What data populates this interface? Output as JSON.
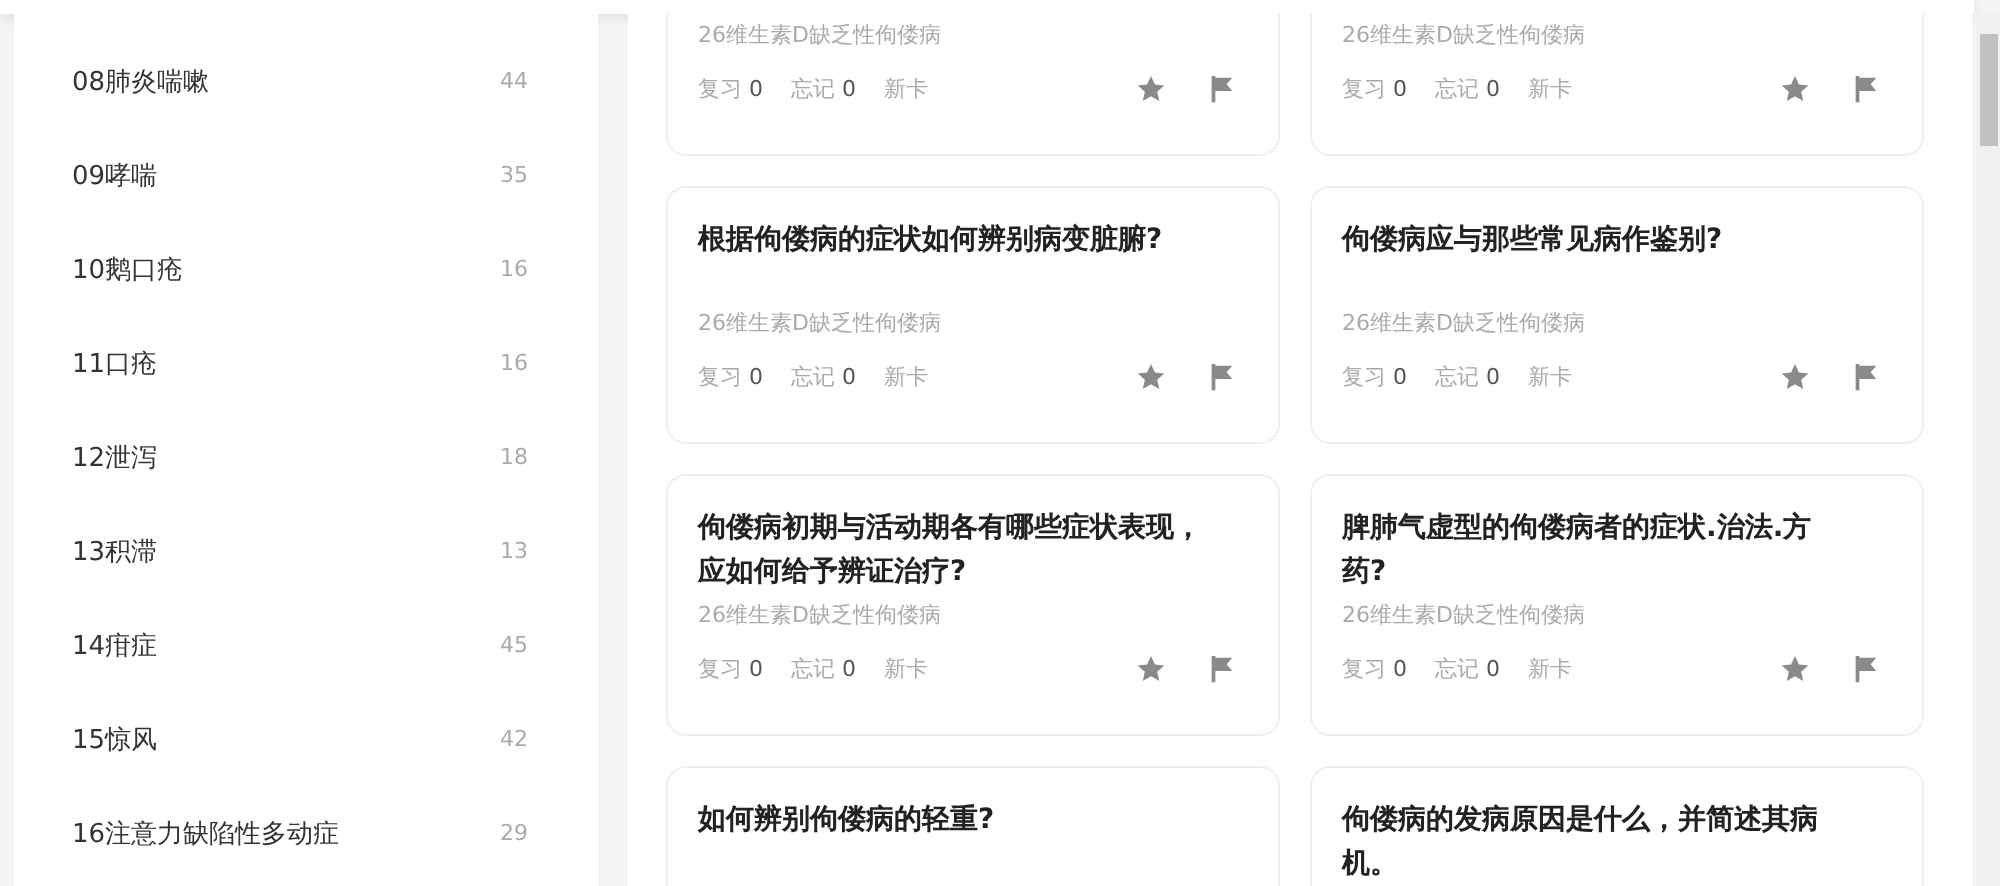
{
  "sidebar": {
    "items": [
      {
        "label": "08肺炎喘嗽",
        "count": "44"
      },
      {
        "label": "09哮喘",
        "count": "35"
      },
      {
        "label": "10鹅口疮",
        "count": "16"
      },
      {
        "label": "11口疮",
        "count": "16"
      },
      {
        "label": "12泄泻",
        "count": "18"
      },
      {
        "label": "13积滞",
        "count": "13"
      },
      {
        "label": "14疳症",
        "count": "45"
      },
      {
        "label": "15惊风",
        "count": "42"
      },
      {
        "label": "16注意力缺陷性多动症",
        "count": "29"
      }
    ]
  },
  "cards": [
    {
      "deck": "26维生素D缺乏性佝偻病",
      "review_label": "复习",
      "review_count": "0",
      "forget_label": "忘记",
      "forget_count": "0",
      "status": "新卡"
    },
    {
      "deck": "26维生素D缺乏性佝偻病",
      "review_label": "复习",
      "review_count": "0",
      "forget_label": "忘记",
      "forget_count": "0",
      "status": "新卡"
    },
    {
      "title": "根据佝偻病的症状如何辨别病变脏腑?",
      "deck": "26维生素D缺乏性佝偻病",
      "review_label": "复习",
      "review_count": "0",
      "forget_label": "忘记",
      "forget_count": "0",
      "status": "新卡"
    },
    {
      "title": "佝偻病应与那些常见病作鉴别?",
      "deck": "26维生素D缺乏性佝偻病",
      "review_label": "复习",
      "review_count": "0",
      "forget_label": "忘记",
      "forget_count": "0",
      "status": "新卡"
    },
    {
      "title": "佝偻病初期与活动期各有哪些症状表现，应如何给予辨证治疗?",
      "deck": "26维生素D缺乏性佝偻病",
      "review_label": "复习",
      "review_count": "0",
      "forget_label": "忘记",
      "forget_count": "0",
      "status": "新卡"
    },
    {
      "title": "脾肺气虚型的佝偻病者的症状.治法.方药?",
      "deck": "26维生素D缺乏性佝偻病",
      "review_label": "复习",
      "review_count": "0",
      "forget_label": "忘记",
      "forget_count": "0",
      "status": "新卡"
    },
    {
      "title": "如何辨别佝偻病的轻重?"
    },
    {
      "title": "佝偻病的发病原因是什么，并简述其病机。"
    }
  ]
}
